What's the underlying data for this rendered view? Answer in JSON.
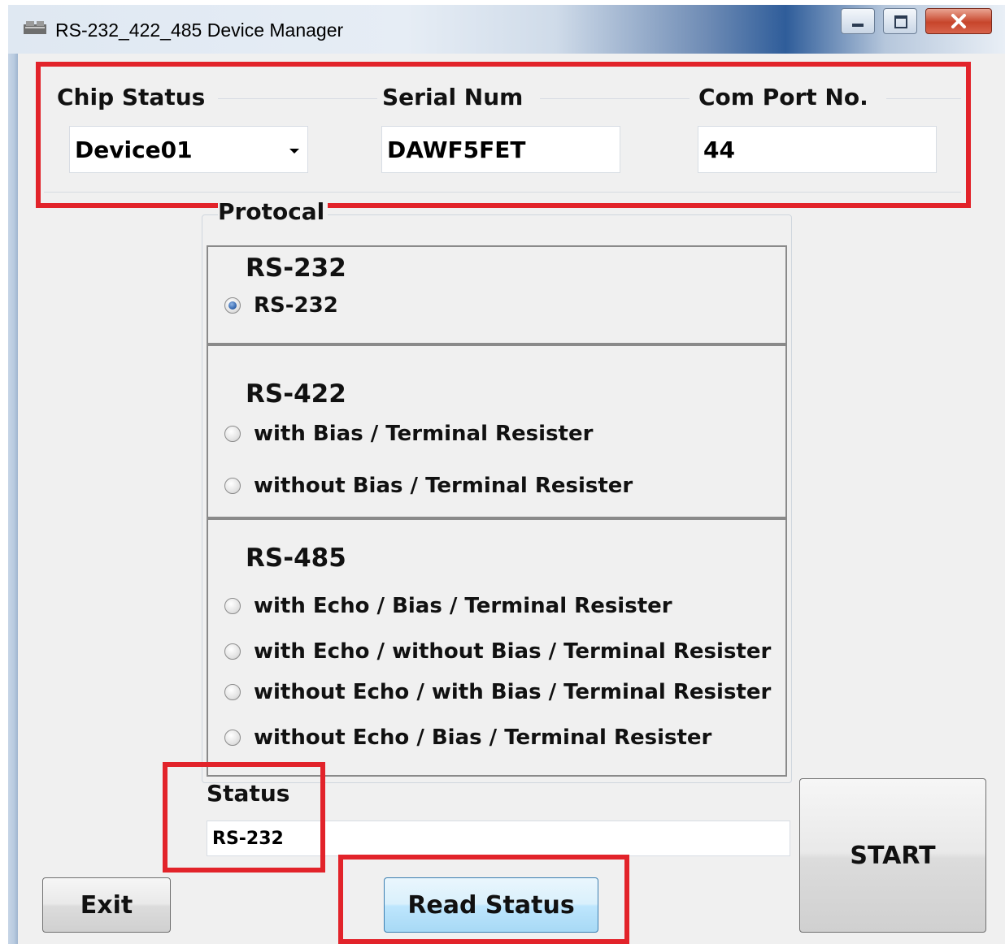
{
  "window": {
    "title": "RS-232_422_485 Device Manager"
  },
  "device": {
    "chip_status_label": "Chip Status",
    "chip_status_value": "Device01",
    "serial_num_label": "Serial Num",
    "serial_num_value": "DAWF5FET",
    "com_port_label": "Com Port No.",
    "com_port_value": "44"
  },
  "protocol": {
    "group_label": "Protocal",
    "rs232": {
      "title": "RS-232",
      "options": [
        "RS-232"
      ]
    },
    "rs422": {
      "title": "RS-422",
      "options": [
        "with Bias / Terminal Resister",
        "without Bias / Terminal Resister"
      ]
    },
    "rs485": {
      "title": "RS-485",
      "options": [
        "with Echo / Bias / Terminal Resister",
        "with Echo / without Bias / Terminal Resister",
        "without Echo / with Bias / Terminal Resister",
        "without Echo / Bias / Terminal Resister"
      ]
    },
    "selected": "RS-232"
  },
  "status": {
    "label": "Status",
    "value": "RS-232"
  },
  "buttons": {
    "exit": "Exit",
    "read_status": "Read Status",
    "start": "START"
  },
  "highlight_color": "#e2232a"
}
